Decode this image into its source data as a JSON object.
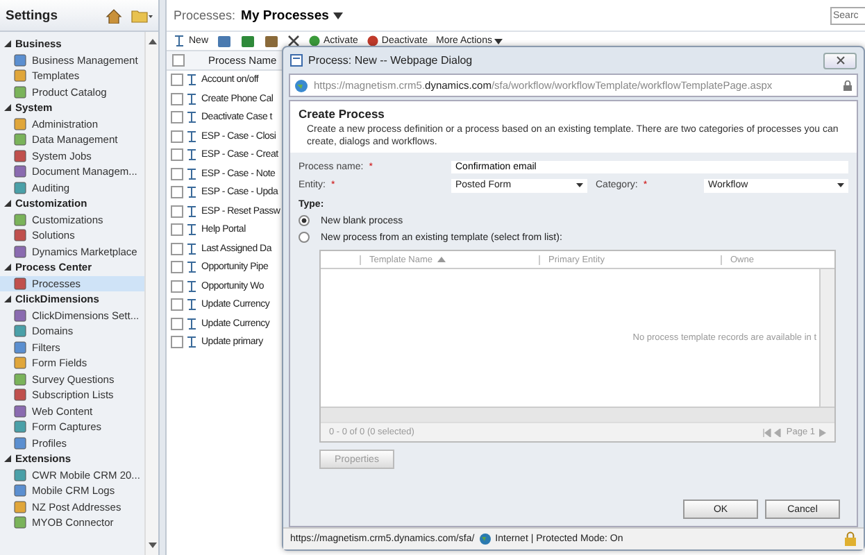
{
  "sidebar": {
    "title": "Settings",
    "groups": [
      {
        "label": "Business",
        "expanded": true,
        "items": [
          {
            "label": "Business Management",
            "selected": false
          },
          {
            "label": "Templates",
            "selected": false
          },
          {
            "label": "Product Catalog",
            "selected": false
          }
        ]
      },
      {
        "label": "System",
        "expanded": true,
        "items": [
          {
            "label": "Administration",
            "selected": false
          },
          {
            "label": "Data Management",
            "selected": false
          },
          {
            "label": "System Jobs",
            "selected": false
          },
          {
            "label": "Document Managem...",
            "selected": false
          },
          {
            "label": "Auditing",
            "selected": false
          }
        ]
      },
      {
        "label": "Customization",
        "expanded": true,
        "items": [
          {
            "label": "Customizations",
            "selected": false
          },
          {
            "label": "Solutions",
            "selected": false
          },
          {
            "label": "Dynamics Marketplace",
            "selected": false
          }
        ]
      },
      {
        "label": "Process Center",
        "expanded": true,
        "items": [
          {
            "label": "Processes",
            "selected": true
          }
        ]
      },
      {
        "label": "ClickDimensions",
        "expanded": true,
        "items": [
          {
            "label": "ClickDimensions Sett...",
            "selected": false
          },
          {
            "label": "Domains",
            "selected": false
          },
          {
            "label": "Filters",
            "selected": false
          },
          {
            "label": "Form Fields",
            "selected": false
          },
          {
            "label": "Survey Questions",
            "selected": false
          },
          {
            "label": "Subscription Lists",
            "selected": false
          },
          {
            "label": "Web Content",
            "selected": false
          },
          {
            "label": "Form Captures",
            "selected": false
          },
          {
            "label": "Profiles",
            "selected": false
          }
        ]
      },
      {
        "label": "Extensions",
        "expanded": true,
        "items": [
          {
            "label": "CWR Mobile CRM 20...",
            "selected": false
          },
          {
            "label": "Mobile CRM Logs",
            "selected": false
          },
          {
            "label": "NZ Post Addresses",
            "selected": false
          },
          {
            "label": "MYOB Connector",
            "selected": false
          }
        ]
      }
    ]
  },
  "main": {
    "view_label": "Processes:",
    "view_name": "My Processes",
    "search": {
      "placeholder": "Searc"
    },
    "toolbar": [
      {
        "kind": "new",
        "label": "New"
      },
      {
        "kind": "print"
      },
      {
        "kind": "excel"
      },
      {
        "kind": "assign"
      },
      {
        "kind": "delete"
      },
      {
        "kind": "activate",
        "label": "Activate"
      },
      {
        "kind": "deactivate",
        "label": "Deactivate"
      },
      {
        "kind": "menu",
        "label": "More Actions"
      }
    ],
    "column": "Process Name",
    "all_checked": false,
    "rows": [
      {
        "name": "Account on/off",
        "checked": false
      },
      {
        "name": "Create Phone Cal",
        "checked": false
      },
      {
        "name": "Deactivate Case t",
        "checked": false
      },
      {
        "name": "ESP - Case - Closi",
        "checked": false
      },
      {
        "name": "ESP - Case - Creat",
        "checked": false
      },
      {
        "name": "ESP - Case - Note",
        "checked": false
      },
      {
        "name": "ESP - Case - Upda",
        "checked": false
      },
      {
        "name": "ESP - Reset Passw",
        "checked": false
      },
      {
        "name": "Help Portal",
        "checked": false
      },
      {
        "name": "Last Assigned Da",
        "checked": false
      },
      {
        "name": "Opportunity Pipe",
        "checked": false
      },
      {
        "name": "Opportunity Wo",
        "checked": false
      },
      {
        "name": "Update Currency",
        "checked": false
      },
      {
        "name": "Update Currency",
        "checked": false
      },
      {
        "name": "Update primary",
        "checked": false
      }
    ]
  },
  "dialog": {
    "title": "Process: New -- Webpage Dialog",
    "address": "https://magnetism.crm5.**dynamics.com**/sfa/workflow/workflowTemplate/workflowTemplatePage.aspx",
    "heading": "Create Process",
    "description": "Create a new process definition or a process based on an existing template. There are two categories of processes you can create, dialogs and workflows.",
    "fields": {
      "name_label": "Process name:",
      "name_value": "Confirmation email",
      "entity_label": "Entity:",
      "entity_value": "Posted Form",
      "category_label": "Category:",
      "category_value": "Workflow",
      "required_mark": "*"
    },
    "type_label": "Type:",
    "options": [
      {
        "label": "New blank process",
        "selected": true
      },
      {
        "label": "New process from an existing template (select from list):",
        "selected": false
      }
    ],
    "grid": {
      "columns": [
        "Template Name",
        "Primary Entity",
        "Owne"
      ],
      "empty": "No process template records are available in t",
      "count": "0 - 0 of 0 (0 selected)",
      "page": "Page 1"
    },
    "properties_button": {
      "label": "Properties",
      "disabled": true
    },
    "buttons": [
      "OK",
      "Cancel"
    ],
    "status": {
      "url": "https://magnetism.crm5.dynamics.com/sfa/",
      "zone": "Internet | Protected Mode: On"
    }
  }
}
